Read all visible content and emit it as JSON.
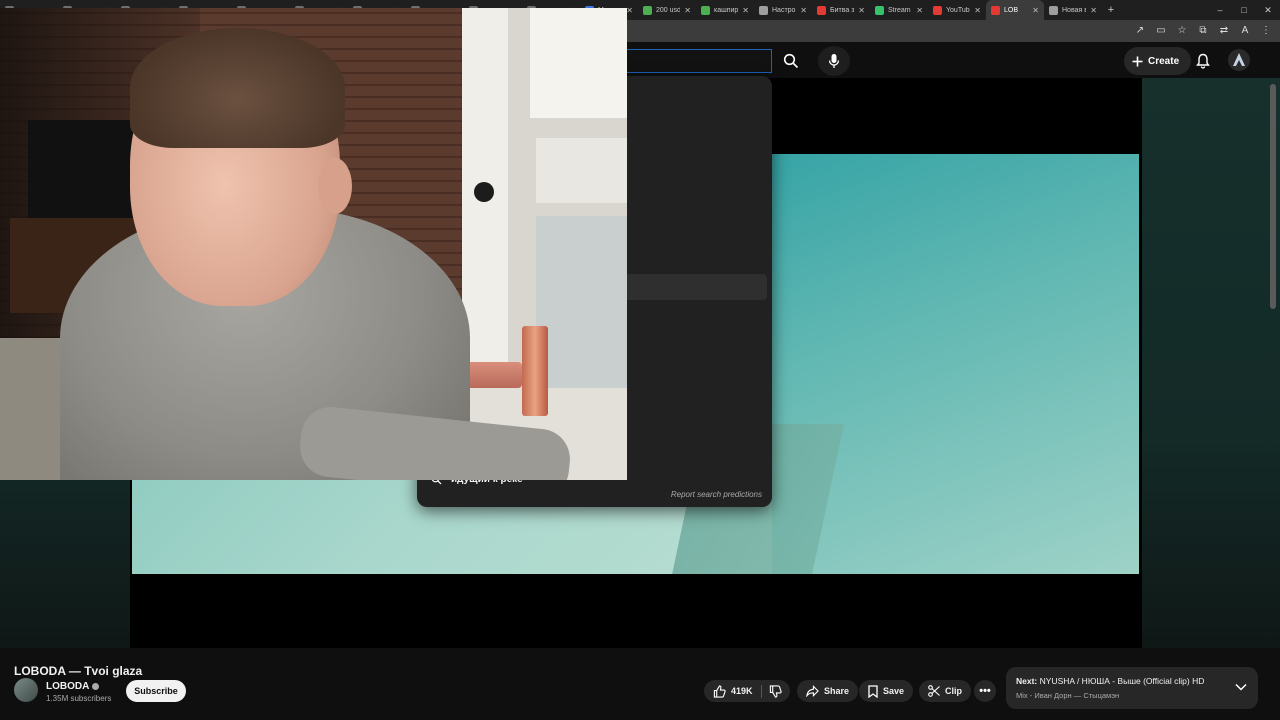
{
  "browser": {
    "tabs": [
      {
        "label": "",
        "color": "#6f6f6f"
      },
      {
        "label": "",
        "color": "#6f6f6f"
      },
      {
        "label": "",
        "color": "#6f6f6f"
      },
      {
        "label": "",
        "color": "#6f6f6f"
      },
      {
        "label": "",
        "color": "#6f6f6f"
      },
      {
        "label": "",
        "color": "#6f6f6f"
      },
      {
        "label": "",
        "color": "#6f6f6f"
      },
      {
        "label": "",
        "color": "#6f6f6f"
      },
      {
        "label": "",
        "color": "#6f6f6f"
      },
      {
        "label": "",
        "color": "#6f6f6f"
      },
      {
        "label": "Мессен",
        "color": "#3a78e7"
      },
      {
        "label": "200 usd",
        "color": "#4caf50"
      },
      {
        "label": "кашпир",
        "color": "#4caf50"
      },
      {
        "label": "Настрой",
        "color": "#9e9e9e"
      },
      {
        "label": "Битва з",
        "color": "#e53935"
      },
      {
        "label": "Stream",
        "color": "#35c26b"
      },
      {
        "label": "YouTube",
        "color": "#e53935"
      },
      {
        "label": "LOB",
        "color": "#e53935"
      },
      {
        "label": "Новая в",
        "color": "#9e9e9e"
      }
    ],
    "active_tab": 17,
    "new_tab": "+",
    "win_controls": [
      "–",
      "□",
      "✕"
    ],
    "addr_icons": [
      "external-link-icon",
      "cast-icon",
      "star-icon",
      "extensions-icon",
      "translate-icon",
      "profile-icon",
      "kebab-menu-icon"
    ]
  },
  "youtube": {
    "create_label": "Create",
    "search_suggestion": "идущий к реке",
    "report_label": "Report search predictions"
  },
  "video": {
    "title": "LOBODA — Tvoi glaza",
    "channel": "LOBODA",
    "subscribers": "1.35M subscribers",
    "subscribe_label": "Subscribe",
    "likes": "419K",
    "share_label": "Share",
    "save_label": "Save",
    "clip_label": "Clip",
    "more_label": "•••"
  },
  "next": {
    "prefix": "Next:",
    "title": "NYUSHA / НЮША - Выше (Official clip) HD",
    "subtitle": "Mix - Иван Дорн — Стыцамэн"
  },
  "colors": {
    "accent_blue": "#1c62b9",
    "ambient": "#17302c",
    "subscribe_bg": "#f1f1f1"
  }
}
